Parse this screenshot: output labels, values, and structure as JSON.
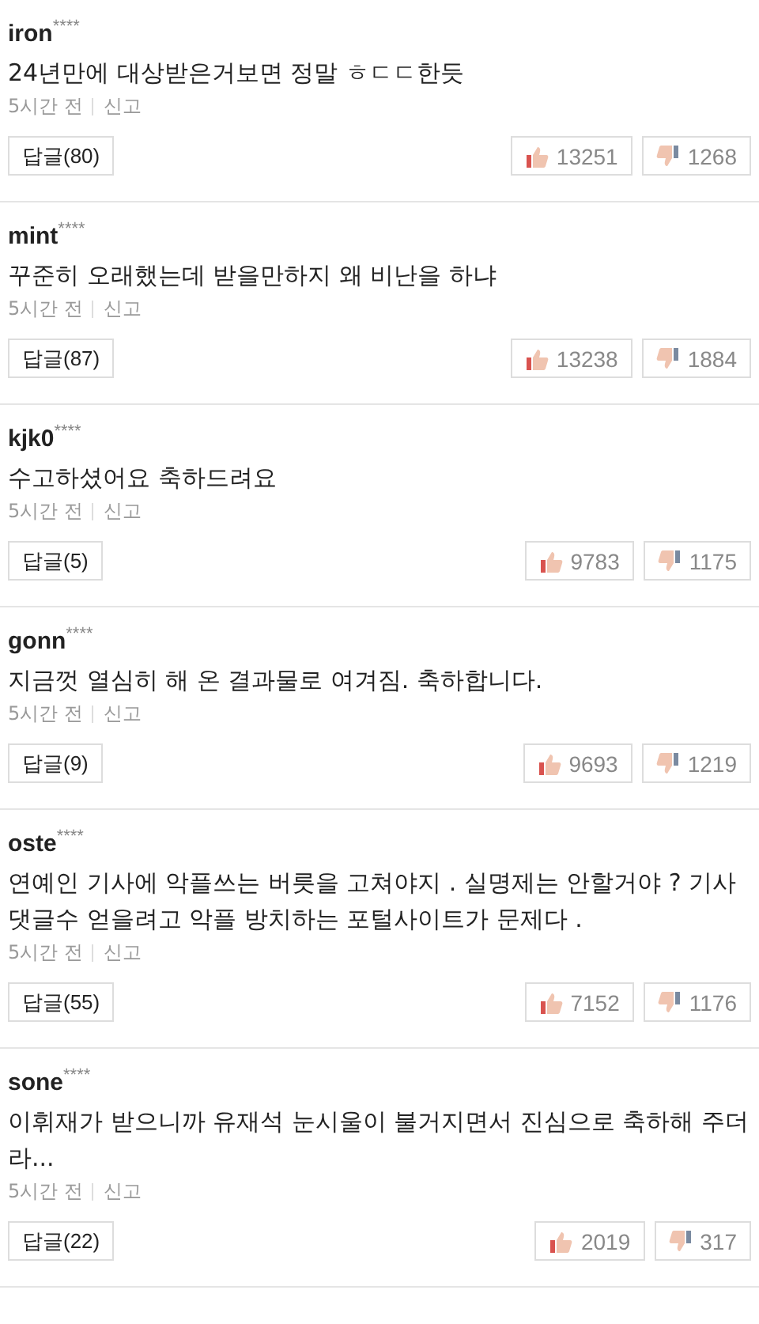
{
  "comments": [
    {
      "author": "iron$^{****}$",
      "text": "24년만에 대상받은거보면 정말 ㅎㄷㄷ한듯",
      "time": "5시간 전",
      "report": "신고",
      "reply": "답글(80)",
      "likes": "13251",
      "dislikes": "1268"
    },
    {
      "author": "mint$^{****}$",
      "text": "꾸준히 오래했는데 받을만하지 왜 비난을 하냐",
      "time": "5시간 전",
      "report": "신고",
      "reply": "답글(87)",
      "likes": "13238",
      "dislikes": "1884"
    },
    {
      "author": "kjk0$^{****}$",
      "text": "수고하셨어요 축하드려요",
      "time": "5시간 전",
      "report": "신고",
      "reply": "답글(5)",
      "likes": "9783",
      "dislikes": "1175"
    },
    {
      "author": "gonn$^{****}$",
      "text": "지금껏 열심히 해 온 결과물로 여겨짐. 축하합니다.",
      "time": "5시간 전",
      "report": "신고",
      "reply": "답글(9)",
      "likes": "9693",
      "dislikes": "1219"
    },
    {
      "author": "oste$^{****}$",
      "text": "연예인 기사에 악플쓰는 버릇을 고쳐야지 . 실명제는 안할거야 ? 기사 댓글수 얻을려고 악플 방치하는 포털사이트가 문제다 .",
      "time": "5시간 전",
      "report": "신고",
      "reply": "답글(55)",
      "likes": "7152",
      "dislikes": "1176"
    },
    {
      "author": "sone$^{****}$",
      "text": "이휘재가 받으니까 유재석 눈시울이 불거지면서 진심으로 축하해 주더라...",
      "time": "5시간 전",
      "report": "신고",
      "reply": "답글(22)",
      "likes": "2019",
      "dislikes": "317"
    }
  ]
}
